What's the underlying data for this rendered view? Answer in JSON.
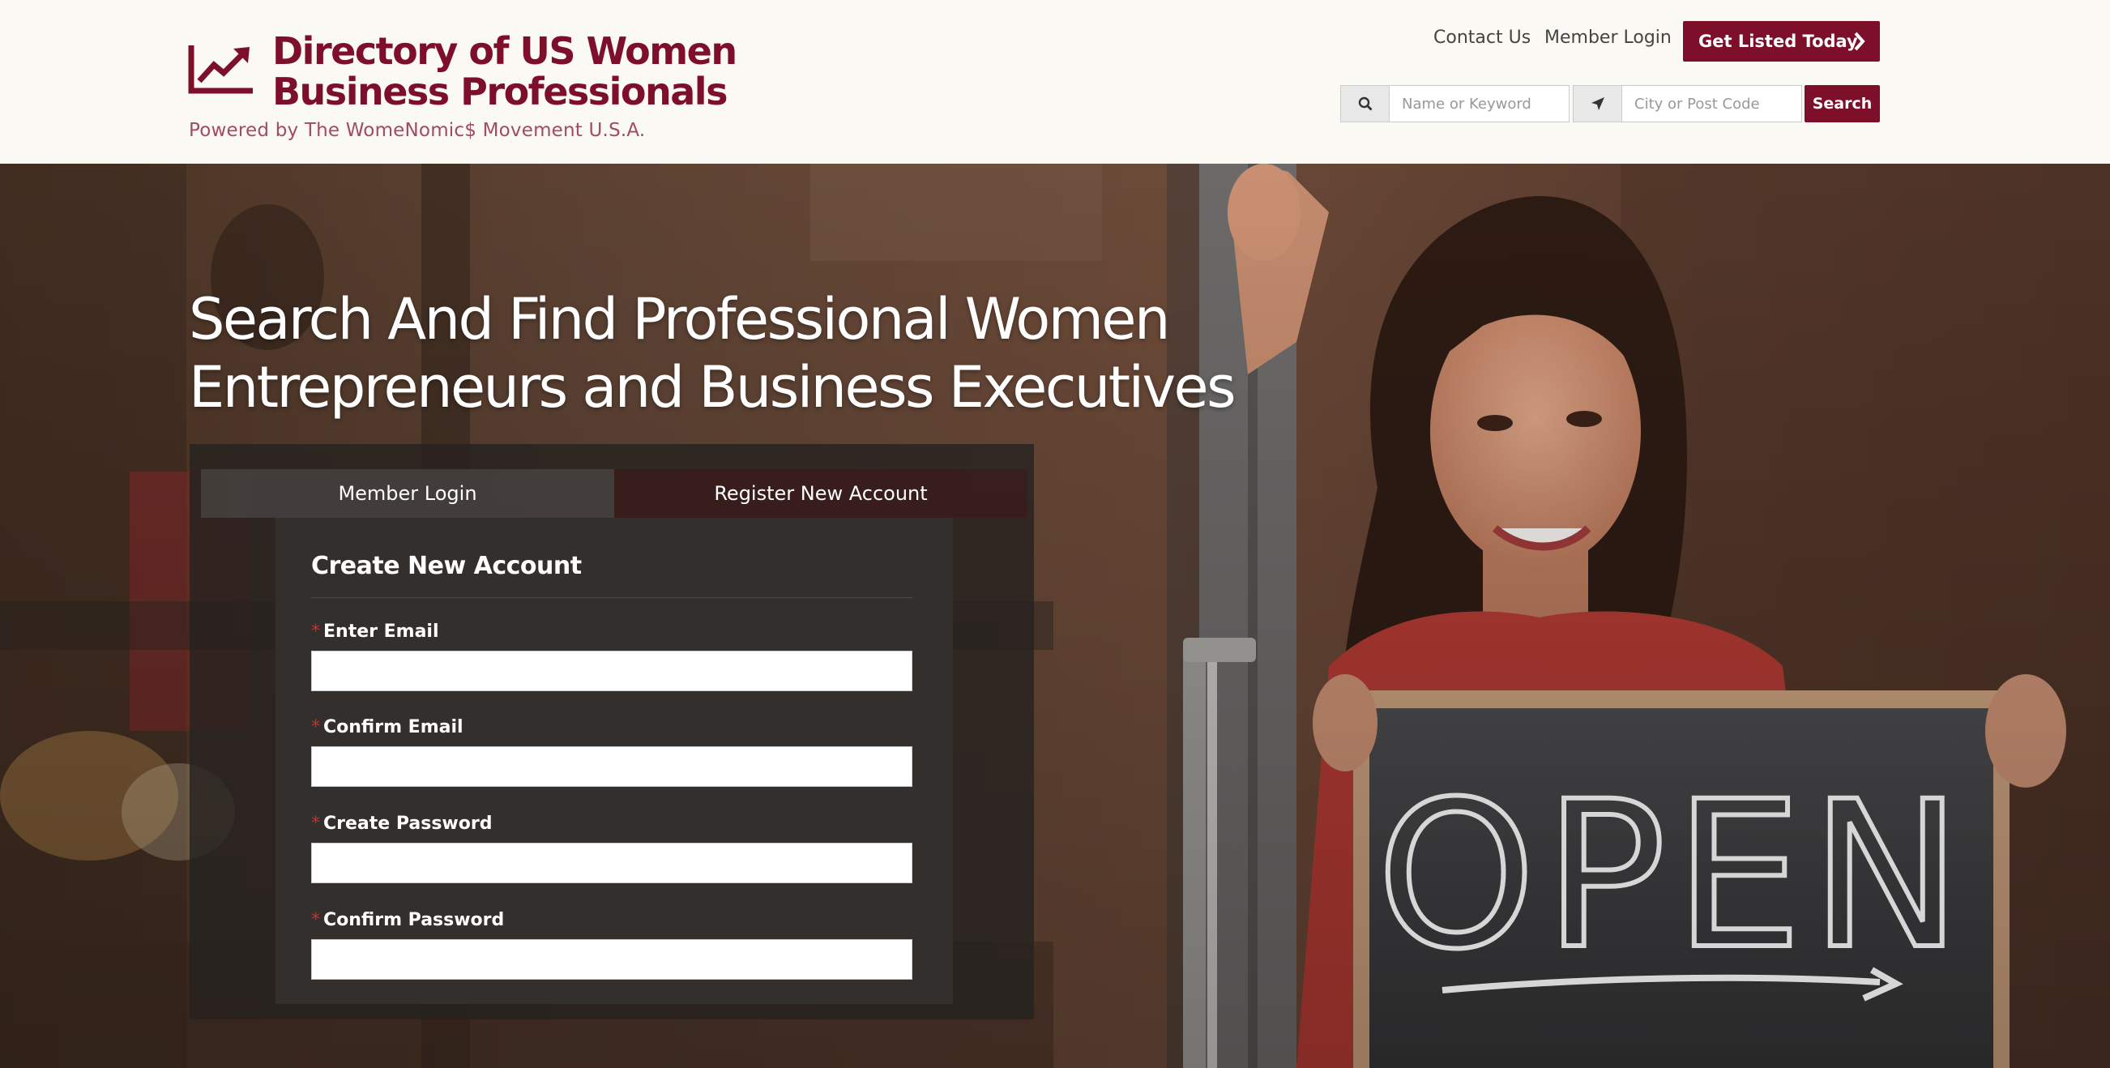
{
  "header": {
    "site_title": "Directory of US Women Business Professionals",
    "tagline": "Powered by The WomeNomic$ Movement U.S.A.",
    "nav": {
      "contact": "Contact Us",
      "login": "Member Login"
    },
    "cta_label": "Get Listed Today",
    "search": {
      "keyword_placeholder": "Name or Keyword",
      "location_placeholder": "City or Post Code",
      "button_label": "Search"
    }
  },
  "hero": {
    "title": "Search And Find Professional Women Entrepreneurs and Business Executives",
    "tabs": {
      "login": "Member Login",
      "register": "Register New Account"
    },
    "form": {
      "heading": "Create New Account",
      "required_marker": "*",
      "fields": [
        {
          "label": "Enter Email",
          "value": ""
        },
        {
          "label": "Confirm Email",
          "value": ""
        },
        {
          "label": "Create Password",
          "value": ""
        },
        {
          "label": "Confirm Password",
          "value": ""
        }
      ]
    },
    "sign_text": "OPEN"
  },
  "colors": {
    "brand": "#7d0f2b",
    "tagline": "#a14b66",
    "header_bg": "#faf9f4",
    "required": "#d12b2b"
  },
  "icons": [
    "trending-up-icon",
    "chevron-right-icon",
    "search-icon",
    "location-arrow-icon"
  ]
}
